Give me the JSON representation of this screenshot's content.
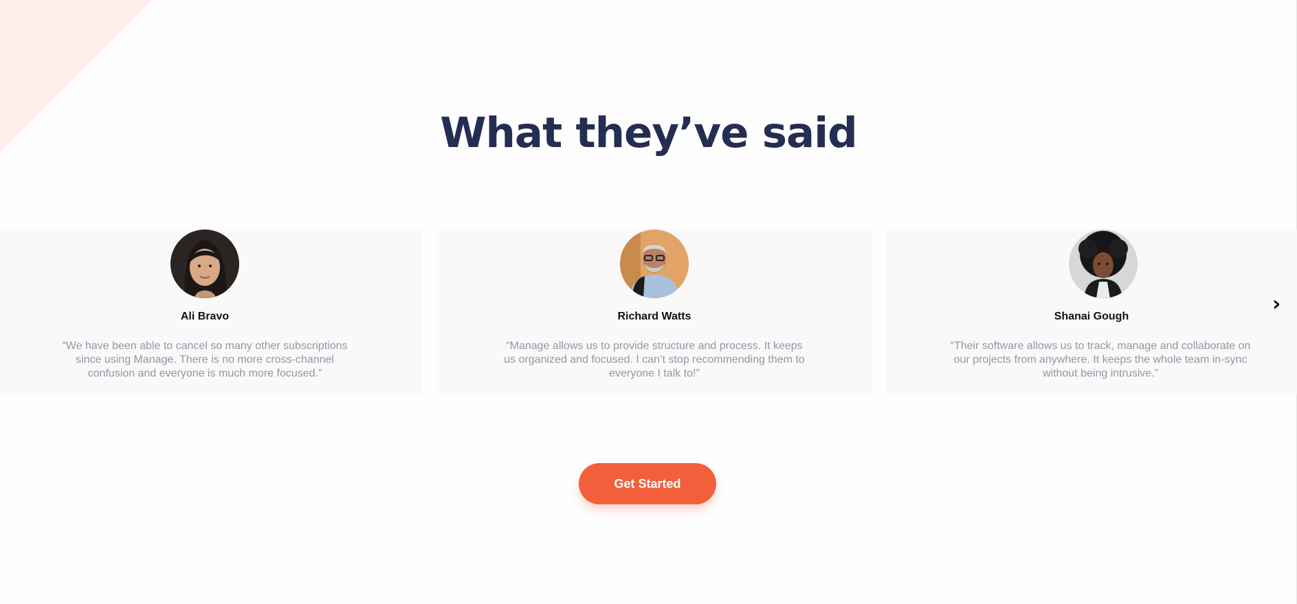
{
  "colors": {
    "title": "#242d52",
    "accent": "#f25f3a",
    "card_bg": "#f9f9f9",
    "quote_text": "#9197a6",
    "decoration": "#fff0ec"
  },
  "section": {
    "title": "What they’ve said"
  },
  "carousel": {
    "prev_icon": "‹",
    "next_icon": "›",
    "testimonials": [
      {
        "name": "Ali Bravo",
        "avatar": "avatar-ali-bravo",
        "quote": "“We have been able to cancel so many other subscriptions since using Manage. There is no more cross-channel confusion and everyone is much more focused.”"
      },
      {
        "name": "Richard Watts",
        "avatar": "avatar-richard-watts",
        "quote": "“Manage allows us to provide structure and process. It keeps us organized and focused. I can’t stop recommending them to everyone I talk to!”"
      },
      {
        "name": "Shanai Gough",
        "avatar": "avatar-shanai-gough",
        "quote": "“Their software allows us to track, manage and collaborate on our projects from anywhere. It keeps the whole team in-sync without being intrusive.”"
      }
    ]
  },
  "cta": {
    "label": "Get Started"
  }
}
